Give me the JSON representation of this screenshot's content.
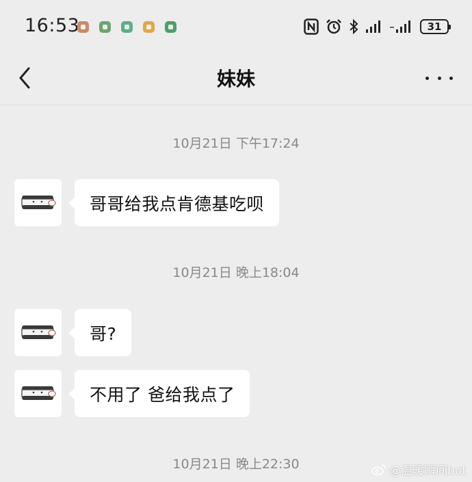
{
  "status_bar": {
    "time": "16:53",
    "battery": "31",
    "notification_icons": [
      {
        "name": "app-notification-icon-1",
        "color": "#c98b6b"
      },
      {
        "name": "app-notification-icon-2",
        "color": "#6aa56f"
      },
      {
        "name": "app-notification-icon-3",
        "color": "#5fae86"
      },
      {
        "name": "app-notification-icon-4",
        "color": "#e0a748"
      },
      {
        "name": "app-notification-icon-5",
        "color": "#4d9e6a"
      }
    ],
    "system_icons": [
      "nfc-icon",
      "alarm-icon",
      "bluetooth-icon",
      "signal-icon",
      "signal-icon-2",
      "battery-icon"
    ]
  },
  "header": {
    "title": "妹妹",
    "back_icon": "chevron-left-icon",
    "more_icon": "more-icon"
  },
  "messages": [
    {
      "type": "timestamp",
      "text": "10月21日 下午17:24"
    },
    {
      "type": "message",
      "sender": "contact",
      "text": "哥哥给我点肯德基吃呗"
    },
    {
      "type": "timestamp",
      "text": "10月21日 晚上18:04"
    },
    {
      "type": "message",
      "sender": "contact",
      "text": "哥?"
    },
    {
      "type": "message",
      "sender": "contact",
      "text": "不用了 爸给我点了"
    },
    {
      "type": "timestamp",
      "text": "10月21日 晚上22:30"
    }
  ],
  "watermark": {
    "text": "@温暖瞬间bot",
    "icon": "weibo-icon"
  },
  "colors": {
    "background": "#ededed",
    "bubble": "#ffffff",
    "timestamp": "#888888"
  }
}
